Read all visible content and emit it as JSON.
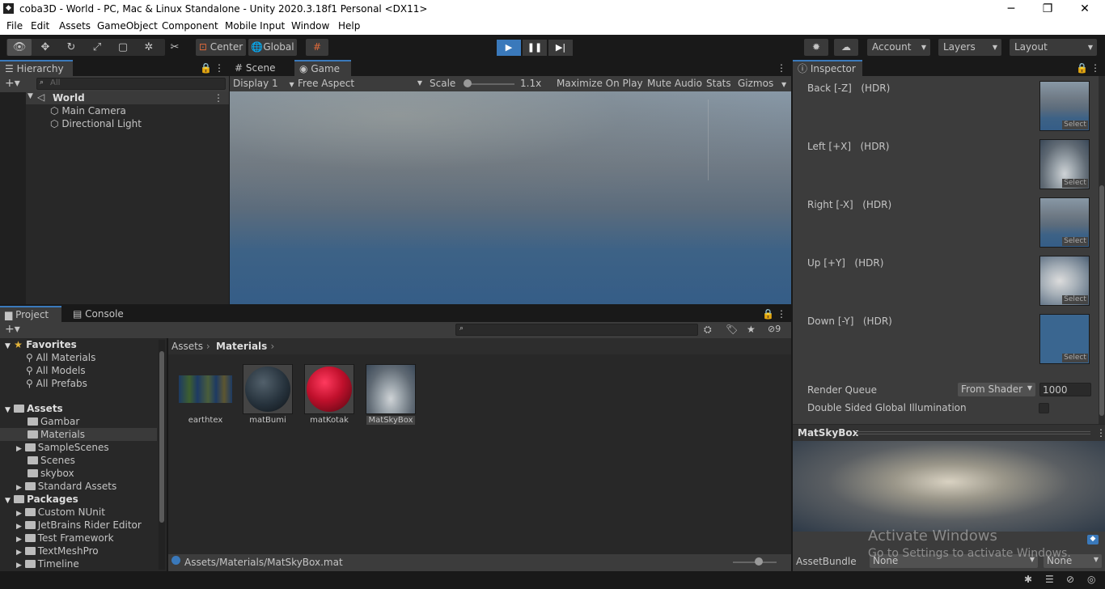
{
  "window": {
    "title": "coba3D - World - PC, Mac & Linux Standalone - Unity 2020.3.18f1 Personal <DX11>",
    "minimize": "─",
    "maximize": "❐",
    "close": "✕"
  },
  "menu": [
    "File",
    "Edit",
    "Assets",
    "GameObject",
    "Component",
    "Mobile Input",
    "Window",
    "Help"
  ],
  "toolbar": {
    "pivot": "Center",
    "space": "Global",
    "account": "Account",
    "layers": "Layers",
    "layout": "Layout"
  },
  "hierarchy": {
    "tab": "Hierarchy",
    "search_placeholder": "All",
    "scene": "World",
    "items": [
      "Main Camera",
      "Directional Light"
    ]
  },
  "game": {
    "tab_scene": "Scene",
    "tab_game": "Game",
    "display": "Display 1",
    "aspect": "Free Aspect",
    "scale_label": "Scale",
    "scale_value": "1.1x",
    "maximize": "Maximize On Play",
    "mute": "Mute Audio",
    "stats": "Stats",
    "gizmos": "Gizmos"
  },
  "project": {
    "tab_project": "Project",
    "tab_console": "Console",
    "hidden_count": "9",
    "favorites": {
      "label": "Favorites",
      "items": [
        "All Materials",
        "All Models",
        "All Prefabs"
      ]
    },
    "assets": {
      "label": "Assets",
      "items": [
        "Gambar",
        "Materials",
        "SampleScenes",
        "Scenes",
        "skybox",
        "Standard Assets"
      ]
    },
    "packages": {
      "label": "Packages",
      "items": [
        "Custom NUnit",
        "JetBrains Rider Editor",
        "Test Framework",
        "TextMeshPro",
        "Timeline"
      ]
    },
    "breadcrumb": [
      "Assets",
      "Materials"
    ],
    "files": [
      "earthtex",
      "matBumi",
      "matKotak",
      "MatSkyBox"
    ],
    "status_path": "Assets/Materials/MatSkyBox.mat"
  },
  "inspector": {
    "tab": "Inspector",
    "faces": [
      {
        "label": "Back [-Z]",
        "hdr": "(HDR)"
      },
      {
        "label": "Left [+X]",
        "hdr": "(HDR)"
      },
      {
        "label": "Right [-X]",
        "hdr": "(HDR)"
      },
      {
        "label": "Up [+Y]",
        "hdr": "(HDR)"
      },
      {
        "label": "Down [-Y]",
        "hdr": "(HDR)"
      }
    ],
    "select_label": "Select",
    "render_queue_label": "Render Queue",
    "render_queue_mode": "From Shader",
    "render_queue_value": "1000",
    "double_sided_label": "Double Sided Global Illumination",
    "preview_title": "MatSkyBox",
    "assetbundle_label": "AssetBundle",
    "assetbundle_value": "None",
    "assetbundle_variant": "None"
  },
  "watermark": {
    "line1": "Activate Windows",
    "line2": "Go to Settings to activate Windows."
  }
}
